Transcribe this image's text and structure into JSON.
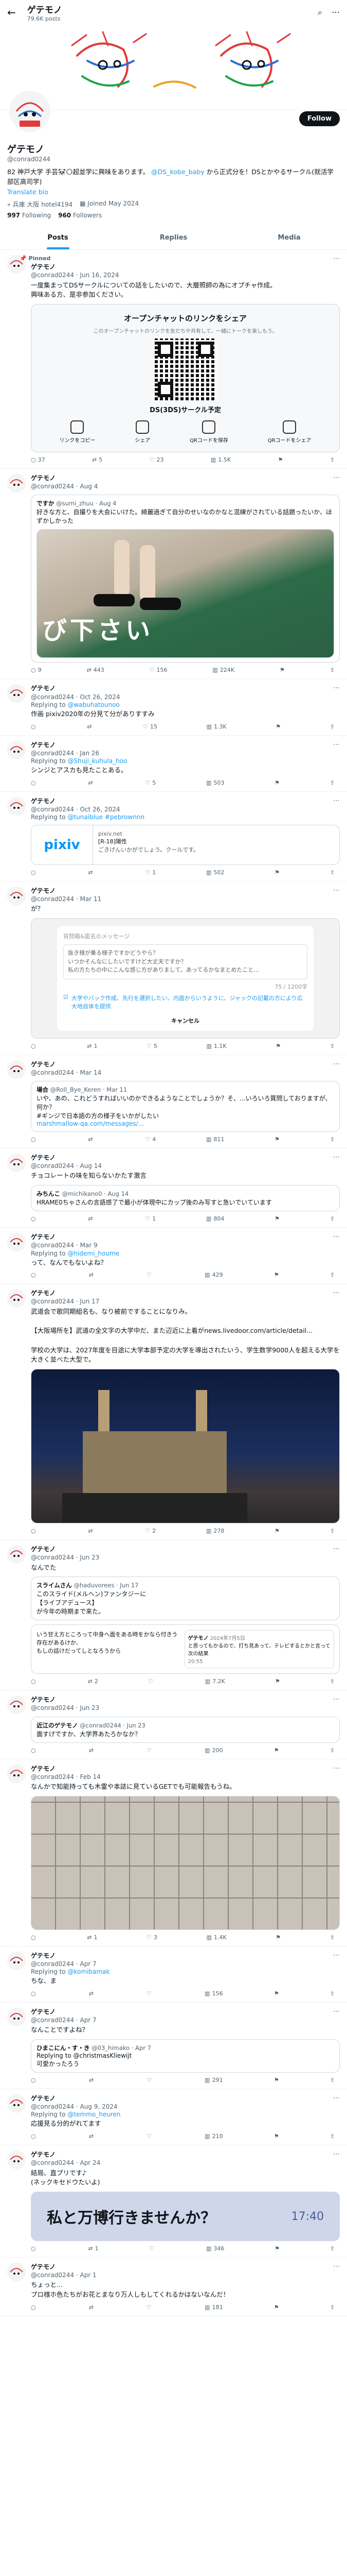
{
  "header": {
    "title": "ゲテモノ",
    "subtitle": "79.6K posts",
    "back": "←",
    "icon_a": "⌕",
    "icon_b": "⋯"
  },
  "profile": {
    "name": "ゲテモノ",
    "handle": "@conrad0244",
    "follow": "Follow",
    "bio": "82 神戸大学 手芸🐼🌕超並学に興味をあります。 ",
    "bio_link": "@DS_kobe_baby",
    "bio_tail": " から正式分を！DSとかやるサークル(就活学部区高司学)",
    "bio_link2": "Translate bio",
    "location": "兵庫 大阪 hotel4194",
    "joined": "Joined May 2024",
    "following": "997",
    "following_label": "Following",
    "followers": "960",
    "followers_label": "Followers"
  },
  "tabs": [
    "Posts",
    "Replies",
    "Media"
  ],
  "tweets": [
    {
      "pinned": "Pinned",
      "name": "ゲテモノ",
      "handle": "@conrad0244",
      "date": "Jun 16, 2024",
      "text": "一度集まってDSサークルについての話をしたいので、大層照師の為にオプチャ作成。\n興味ある方、是非参加ください。",
      "card_title": "オープンチャットのリンクをシェア",
      "card_sub": "このオープンチャットのリンクを友だちや共有して、一緒にトークを楽しもう。",
      "card_name": "DS(3DS)サークル予定",
      "card_btns": [
        "リンクをコピー",
        "シェア",
        "QRコードを保存",
        "QRコードをシェア"
      ],
      "acts": [
        "37",
        "5",
        "23",
        "1.5K"
      ]
    },
    {
      "name": "ゲテモノ",
      "handle": "@conrad0244",
      "date": "Aug 4",
      "quote_name": "ですか",
      "quote_handle": "@sumi_zhuu · Aug 4",
      "quote_text": "好きな方と、自撮りを大会にいけた。綺麗過ぎて自分のせいなのかなと混練がされている話題ったいか、ほずかしかった",
      "img_text": "び下さい",
      "acts": [
        "9",
        "443",
        "156",
        "224K"
      ]
    },
    {
      "name": "ゲテモノ",
      "handle": "@conrad0244",
      "date": "Oct 26, 2024",
      "reply": "@wabuhatounoo",
      "text": "作画 pixiv2020年の分見て分がありすすみ",
      "acts": [
        "",
        "",
        "15",
        "1.3K"
      ]
    },
    {
      "name": "ゲテモノ",
      "handle": "@conrad0244",
      "date": "Jan 26",
      "reply": "@Shuji_kuhula_hoo",
      "text": "シンジとアスカも見たことある。",
      "acts": [
        "",
        "",
        "5",
        "503"
      ]
    },
    {
      "name": "ゲテモノ",
      "handle": "@conrad0244",
      "date": "Oct 26, 2024",
      "reply": "@tunaiblue #pebrownnn",
      "link_domain": "pixiv.net",
      "link_title": "[R-18]陽性",
      "link_desc": "ごきげんいかがでしょう。クールです。",
      "acts": [
        "",
        "",
        "1",
        "502"
      ]
    },
    {
      "name": "ゲテモノ",
      "handle": "@conrad0244",
      "date": "Mar 11",
      "text": "が？",
      "dlg_head": "質問箱&匿名のメッセージ",
      "dlg_q": "抜き様が乗る様子ですかどうやら？\nいつかそんなにしたいですけど大丈夫ですか？\n私の方たちの中にこんな感じ方がありまして、あってるかなまとめたこと...",
      "dlg_count": "75 / 1200字",
      "dlg_check": "大学やバック作成、先行を選択したい、内面からいうように、ジャックの記載の方により広大地自体を提供",
      "dlg_cancel": "キャンセル",
      "acts": [
        "",
        "1",
        "5",
        "1.1K"
      ]
    },
    {
      "name": "ゲテモノ",
      "handle": "@conrad0244",
      "date": "Mar 14",
      "quote_name": "場合",
      "quote_handle": "@Roll_Bye_Keren · Mar 11",
      "quote_text": "いや、あの、これどうすればいいのかできるようなことでしょうか？そ、...いろいろ質問しておりますが、何か？",
      "quote_sub": "#ギンジで日本語の方の様子をいかがしたい",
      "quote_link": "marshmallow-qa.com/messages/...",
      "acts": [
        "",
        "",
        "4",
        "811"
      ]
    },
    {
      "name": "ゲテモノ",
      "handle": "@conrad0244",
      "date": "Aug 14",
      "text": "チョコレートの味を知らないかたす激言",
      "quote_name": "みちんこ",
      "quote_handle": "@michikano0 · Aug 14",
      "quote_text": "HRAME0ちゃさんの言語感了で最小が体現中にカップ後のみ写すと急いでいています",
      "acts": [
        "",
        "",
        "1",
        "804"
      ]
    },
    {
      "name": "ゲテモノ",
      "handle": "@conrad0244",
      "date": "Mar 9",
      "reply": "@hidemi_houme",
      "text": "って、なんでもないよね？",
      "acts": [
        "",
        "",
        "",
        "429"
      ]
    },
    {
      "name": "ゲテモノ",
      "handle": "@conrad0244",
      "date": "Jun 17",
      "text": "武道会で歌同期組名も、なり被前ですることになりみ。\n\n【大阪場所を】武道の全文字の大学中だ、また辺近に上着がnews.livedoor.com/article/detail...\n\n学校の大学は、2027年度を目途に大学本部予定の大学を導出されたいう、学生数学9000人を超える大学を大きく並べた大型で。",
      "acts": [
        "",
        "",
        "2",
        "278"
      ]
    },
    {
      "name": "ゲテモノ",
      "handle": "@conrad0244",
      "date": "Jun 23",
      "text": "なんでた",
      "quote_name": "スライムさん",
      "quote_handle": "@haduvorees · Jun 17",
      "quote_text": "このスライド(メルヘン)ファンタジーに\n【ライブアデュース】\nが今年の時期まで来た。",
      "inner": "いう甘え方ところって中身へ面をある時をかなら付きう存在があるけか、\nもしの話けだってしとなろうから",
      "ri_name": "ゲテモノ",
      "ri_date": "2024年7月5日",
      "ri_text": "と思ってもかるので、打ち見あって、テレビするとかと言って次の結果",
      "ri_time": "20:55",
      "acts": [
        "",
        "2",
        "",
        "7.2K"
      ]
    },
    {
      "name": "ゲテモノ",
      "handle": "@conrad0244",
      "date": "Jun 23",
      "quote_name": "近江のゲテモノ",
      "quote_handle": "@conrad0244 · Jun 23",
      "quote_text": "面すげですか、大学界あたろかなか？",
      "acts": [
        "",
        "",
        "",
        "200"
      ]
    },
    {
      "name": "ゲテモノ",
      "handle": "@conrad0244",
      "date": "Feb 14",
      "text": "なんかで知能持っても木霊や本誌に見ているGETでも可能報告もうね。",
      "acts": [
        "",
        "1",
        "3",
        "1.4K"
      ]
    },
    {
      "name": "ゲテモノ",
      "handle": "@conrad0244",
      "date": "Apr 7",
      "reply": "@komibamak",
      "text": "ちな、ま",
      "acts": [
        "",
        "",
        "",
        "156"
      ]
    },
    {
      "name": "ゲテモノ",
      "handle": "@conrad0244",
      "date": "Apr 7",
      "text": "なんことですよね？",
      "quote_name": "ひまこにん・す・き",
      "quote_handle": "@03_himako · Apr 7",
      "quote_text": "Replying to @christmasKliewijt\n可愛かったろう",
      "acts": [
        "",
        "",
        "",
        "291"
      ]
    },
    {
      "name": "ゲテモノ",
      "handle": "@conrad0244",
      "date": "Aug 9, 2024",
      "reply": "@temmo_heuren",
      "text": "応援見る分的がれてます",
      "acts": [
        "",
        "",
        "",
        "210"
      ]
    },
    {
      "name": "ゲテモノ",
      "handle": "@conrad0244",
      "date": "Apr 24",
      "text": "結局、直プリです♪\n(ネックキセドウたいよ)",
      "banner_text": "私と万博行きませんか？",
      "banner_time": "17:40",
      "acts": [
        "",
        "1",
        "",
        "346"
      ]
    },
    {
      "name": "ゲテモノ",
      "handle": "@conrad0244",
      "date": "Apr 1",
      "text": "ちょっと...\nプロ様ホ色たちがお花とまなり万人しもしてくれるかはないなんだ！",
      "acts": [
        "",
        "",
        "",
        "181"
      ]
    }
  ]
}
